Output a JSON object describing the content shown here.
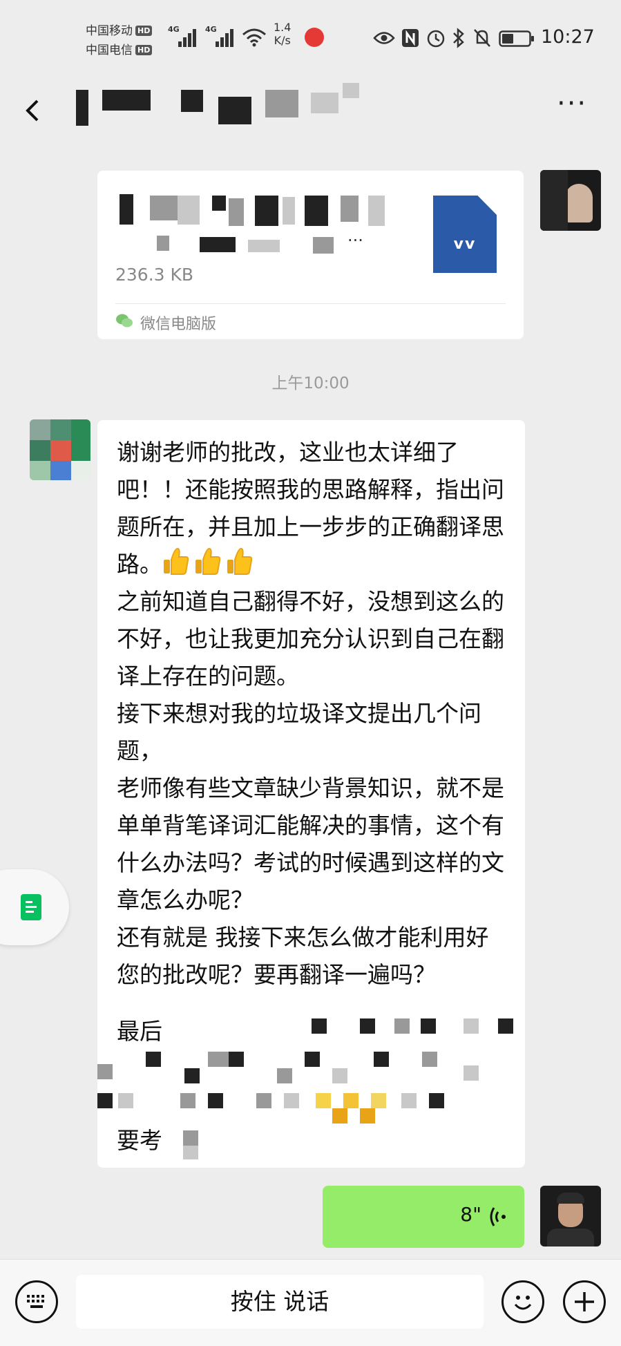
{
  "status_bar": {
    "carrier_1": "中国移动",
    "carrier_2": "中国电信",
    "hd_badge": "HD",
    "network_1": "4G",
    "network_2": "4G",
    "speed_value": "1.4",
    "speed_unit": "K/s",
    "time": "10:27",
    "icons": [
      "eye-icon",
      "nfc-icon",
      "alarm-icon",
      "bluetooth-icon",
      "mute-icon",
      "battery-icon"
    ]
  },
  "title_bar": {
    "back_icon": "back-arrow-icon",
    "more_label": "···"
  },
  "file_message": {
    "file_size": "236.3 KB",
    "source": "微信电脑版",
    "doc_letters": "vv",
    "trailing": "..."
  },
  "time_divider": "上午10:00",
  "text_message": {
    "text": "谢谢老师的批改，这业也太详细了吧！！还能按照我的思路解释，指出问题所在，并且加上一步步的正确翻译思路。",
    "text_2": "之前知道自己翻得不好，没想到这么的不好，也让我更加充分认识到自己在翻译上存在的问题。\n接下来想对我的垃圾译文提出几个问题，\n老师像有些文章缺少背景知识，就不是单单背笔译词汇能解决的事情，这个有什么办法吗？考试的时候遇到这样的文章怎么办呢？\n还有就是 我接下来怎么做才能利用好您的批改呢？要再翻译一遍吗？",
    "partial_1": "最后",
    "partial_2": "要考",
    "emoji_name": "thumbs-up-icon",
    "emoji_count": 3
  },
  "voice_message": {
    "duration": "8\"",
    "icon": "voice-wave-icon"
  },
  "input_bar": {
    "hold_to_talk": "按住 说话",
    "left_icon": "keyboard-icon",
    "emoji_icon": "emoji-icon",
    "plus_icon": "plus-icon"
  },
  "colors": {
    "background": "#ededed",
    "bubble_self": "#95ec69",
    "bubble_other": "#ffffff",
    "accent": "#07c160"
  }
}
